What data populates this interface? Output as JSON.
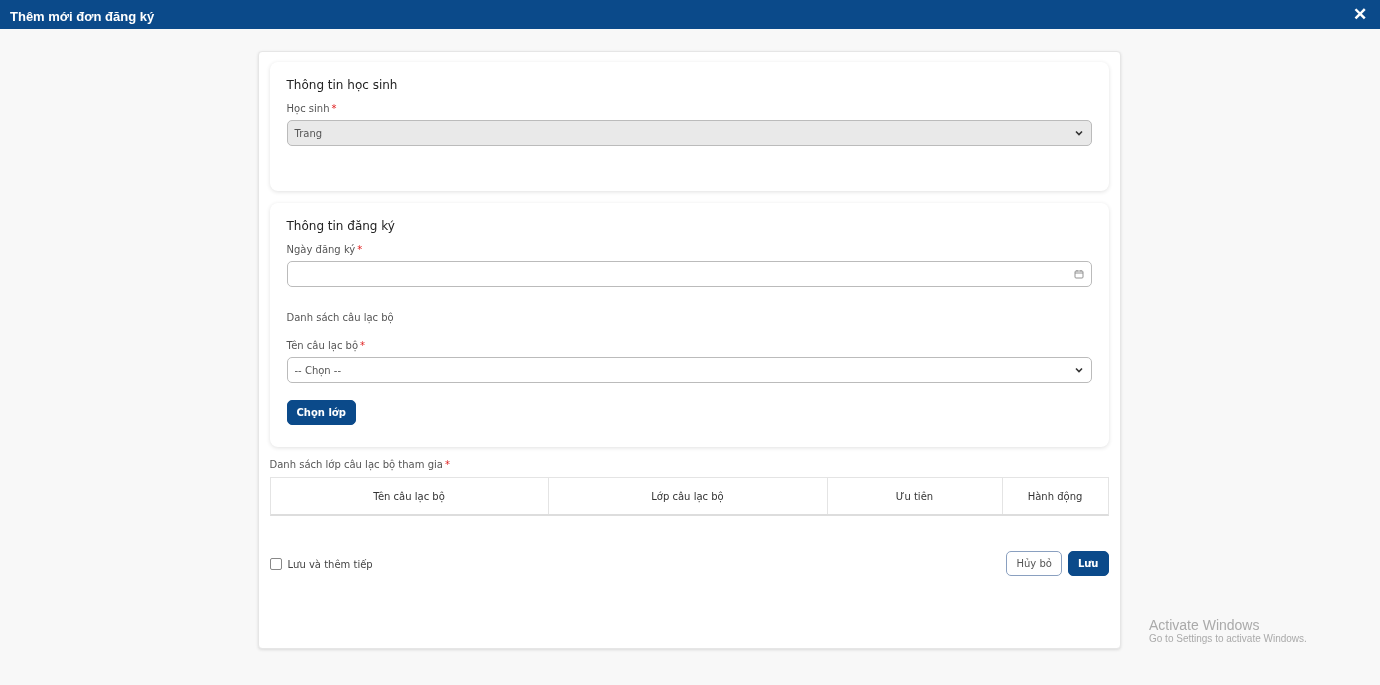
{
  "window": {
    "title": "Thêm mới đơn đăng ký",
    "close": "✕"
  },
  "student_section": {
    "title": "Thông tin học sinh",
    "fields": [
      {
        "label": "Học sinh",
        "required_mark": "*",
        "kind": "select",
        "value": "Trang",
        "disabled": true
      }
    ]
  },
  "registration_section": {
    "title": "Thông tin đăng ký",
    "fields": [
      {
        "label": "Ngày đăng ký",
        "required_mark": "*",
        "kind": "date",
        "disabled": false
      },
      {
        "kind": "heading",
        "label": "Danh sách câu lạc bộ"
      },
      {
        "label": "Tên câu lạc bộ",
        "required_mark": "*",
        "kind": "select",
        "value": "-- Chọn --",
        "disabled": false
      }
    ],
    "button": "Chọn lớp"
  },
  "classes_table": {
    "label": "Danh sách lớp câu lạc bộ tham gia",
    "required_mark": "*",
    "columns": [
      "Tên câu lạc bộ",
      "Lớp câu lạc bộ",
      "Ưu tiên",
      "Hành động"
    ]
  },
  "save_and_add": {
    "label": "Lưu và thêm tiếp",
    "checked": false
  },
  "buttons": [
    {
      "label": "Hủy bỏ",
      "kind": "secondary"
    },
    {
      "label": "Lưu",
      "kind": "primary"
    }
  ],
  "os_notice": {
    "title": "Activate Windows",
    "subtitle": "Go to Settings to activate Windows."
  }
}
